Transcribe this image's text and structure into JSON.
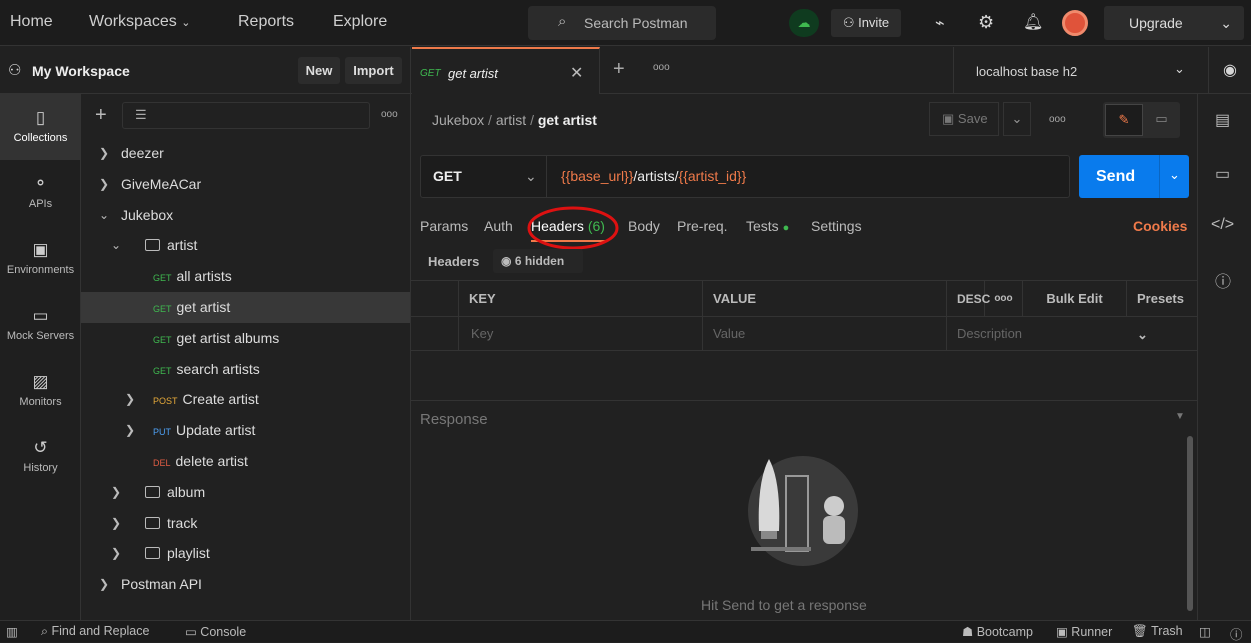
{
  "topbar": {
    "home": "Home",
    "workspaces": "Workspaces",
    "reports": "Reports",
    "explore": "Explore",
    "search": "Search Postman",
    "invite": "Invite",
    "upgrade": "Upgrade"
  },
  "workspace": {
    "name": "My Workspace",
    "new": "New",
    "import": "Import"
  },
  "tab": {
    "method": "GET",
    "title": "get artist"
  },
  "environment": "localhost base h2",
  "rail": [
    {
      "label": "Collections",
      "icon": "collections-icon"
    },
    {
      "label": "APIs",
      "icon": "apis-icon"
    },
    {
      "label": "Environments",
      "icon": "environments-icon"
    },
    {
      "label": "Mock Servers",
      "icon": "mock-servers-icon"
    },
    {
      "label": "Monitors",
      "icon": "monitors-icon"
    },
    {
      "label": "History",
      "icon": "history-icon"
    }
  ],
  "tree": [
    {
      "label": "deezer",
      "level": 0,
      "type": "collection",
      "chev": "›"
    },
    {
      "label": "GiveMeACar",
      "level": 0,
      "type": "collection",
      "chev": "›"
    },
    {
      "label": "Jukebox",
      "level": 0,
      "type": "collection",
      "chev": "⌄"
    },
    {
      "label": "artist",
      "level": 1,
      "type": "folder",
      "chev": "⌄"
    },
    {
      "label": "all artists",
      "level": 2,
      "type": "request",
      "method": "GET"
    },
    {
      "label": "get artist",
      "level": 2,
      "type": "request",
      "method": "GET",
      "selected": true
    },
    {
      "label": "get artist albums",
      "level": 2,
      "type": "request",
      "method": "GET"
    },
    {
      "label": "search artists",
      "level": 2,
      "type": "request",
      "method": "GET"
    },
    {
      "label": "Create artist",
      "level": 2,
      "type": "request",
      "method": "POST",
      "chev": "›"
    },
    {
      "label": "Update artist",
      "level": 2,
      "type": "request",
      "method": "PUT",
      "chev": "›"
    },
    {
      "label": "delete artist",
      "level": 2,
      "type": "request",
      "method": "DEL"
    },
    {
      "label": "album",
      "level": 1,
      "type": "folder",
      "chev": "›"
    },
    {
      "label": "track",
      "level": 1,
      "type": "folder",
      "chev": "›"
    },
    {
      "label": "playlist",
      "level": 1,
      "type": "folder",
      "chev": "›"
    },
    {
      "label": "Postman API",
      "level": 0,
      "type": "collection",
      "chev": "›"
    }
  ],
  "breadcrumb": {
    "collection": "Jukebox",
    "folder": "artist",
    "request": "get artist",
    "save": "Save"
  },
  "request": {
    "method": "GET",
    "url_var1": "{{base_url}}",
    "url_path": "/artists/",
    "url_var2": "{{artist_id}}",
    "send": "Send"
  },
  "req_tabs": {
    "params": "Params",
    "auth": "Auth",
    "headers": "Headers",
    "headers_count": "(6)",
    "body": "Body",
    "prereq": "Pre-req.",
    "tests": "Tests",
    "settings": "Settings",
    "cookies": "Cookies"
  },
  "headers": {
    "label": "Headers",
    "hidden": "6 hidden",
    "key": "KEY",
    "value": "VALUE",
    "desc": "DESC",
    "bulk_edit": "Bulk Edit",
    "presets": "Presets",
    "key_ph": "Key",
    "value_ph": "Value",
    "desc_ph": "Description"
  },
  "response": {
    "label": "Response",
    "hint": "Hit Send to get a response"
  },
  "statusbar": {
    "find": "Find and Replace",
    "console": "Console",
    "bootcamp": "Bootcamp",
    "runner": "Runner",
    "trash": "Trash"
  }
}
